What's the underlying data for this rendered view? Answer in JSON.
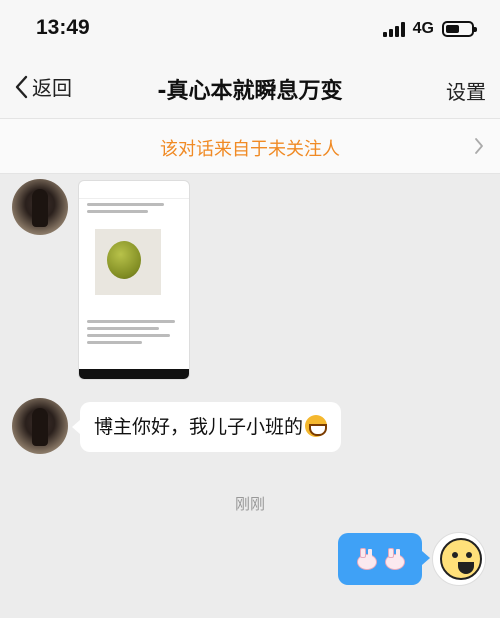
{
  "status_bar": {
    "time": "13:49",
    "network": "4G",
    "battery_level": 0.55
  },
  "nav": {
    "back_label": "返回",
    "title": "-真心本就瞬息万变",
    "settings_label": "设置"
  },
  "notice": {
    "text": "该对话来自于未关注人"
  },
  "messages": [
    {
      "sender": "other",
      "type": "image",
      "icon": "chat-screenshot-image"
    },
    {
      "sender": "other",
      "type": "text",
      "text": "博主你好，我儿子小班的",
      "emoji": "grinning-face"
    },
    {
      "sender": "timestamp",
      "text": "刚刚"
    },
    {
      "sender": "me",
      "type": "sticker",
      "icon": "bunny-faces-sticker"
    }
  ],
  "colors": {
    "notice_text": "#f08a24",
    "my_bubble": "#3fa1f6",
    "page_bg": "#ececec"
  }
}
